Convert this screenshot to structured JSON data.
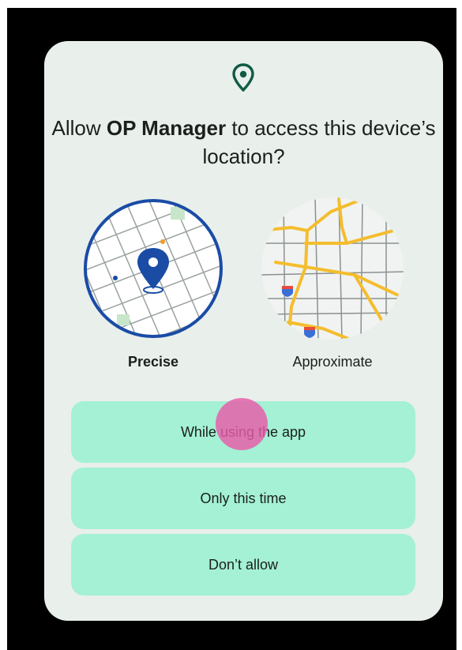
{
  "dialog": {
    "icon": "location-pin-icon",
    "title_prefix": "Allow ",
    "app_name": "OP Manager",
    "title_suffix": " to access this device’s location?"
  },
  "options": {
    "precise_label": "Precise",
    "approximate_label": "Approximate",
    "selected": "Precise"
  },
  "buttons": {
    "while_using": "While using the app",
    "only_this_time": "Only this time",
    "dont_allow": "Don’t allow"
  },
  "colors": {
    "dialog_bg": "#e9efeb",
    "button_bg": "#a4f1d5",
    "accent_green": "#0f5b46",
    "precise_ring": "#1a4ca6",
    "road_yellow": "#f4bd2e",
    "touch_indicator": "#e85aa8"
  }
}
